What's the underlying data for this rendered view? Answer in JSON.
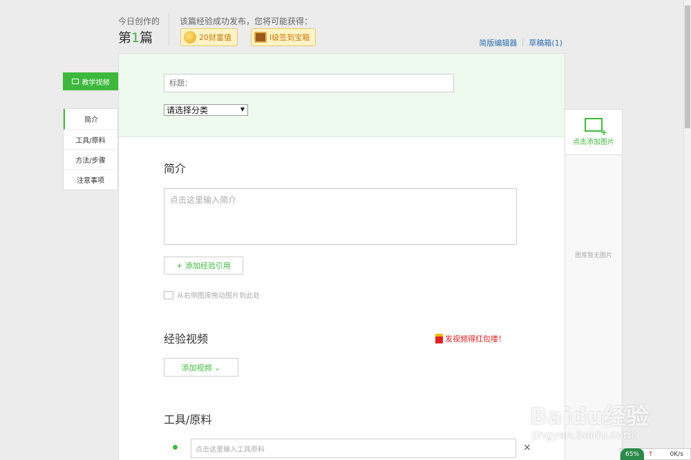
{
  "header": {
    "today_label": "今日创作的",
    "today_count_prefix": "第",
    "today_count_number": "1",
    "today_count_suffix": "篇",
    "reward_tip": "该篇经验成功发布，您将可能获得：",
    "reward_wealth": "20财富值",
    "reward_chest": "I级签到宝箱",
    "simple_editor_link": "简版编辑器",
    "draft_box_link": "草稿箱(1)"
  },
  "sidebar": {
    "video_tutorial": "教学视频",
    "items": [
      {
        "label": "简介"
      },
      {
        "label": "工具/原料"
      },
      {
        "label": "方法/步骤"
      },
      {
        "label": "注意事项"
      }
    ]
  },
  "form": {
    "title_placeholder": "标题：",
    "category_selected": "请选择分类",
    "intro_heading": "简介",
    "intro_placeholder": "点击这里输入简介",
    "add_reference_button": "+ 添加经验引用",
    "drag_hint": "从右侧图库拖动图片到此处",
    "video_heading": "经验视频",
    "red_packet_link": "发视频得红包喽！",
    "add_video_button": "添加视频 ⌄",
    "tools_heading": "工具/原料",
    "tool_placeholder": "点击这里输入工具原料",
    "tool_remove": "×"
  },
  "image_panel": {
    "add_image": "点击添加图片",
    "empty_text": "图库暂无图片"
  },
  "watermark": {
    "brand": "Baidu经验",
    "url": "jingyan.baidu.com"
  },
  "speed_widget": {
    "percent": "65%",
    "rate": "0K/s"
  },
  "colors": {
    "accent_green": "#3db83d",
    "link_blue": "#2e6fb5",
    "alert_red": "#e02020"
  }
}
